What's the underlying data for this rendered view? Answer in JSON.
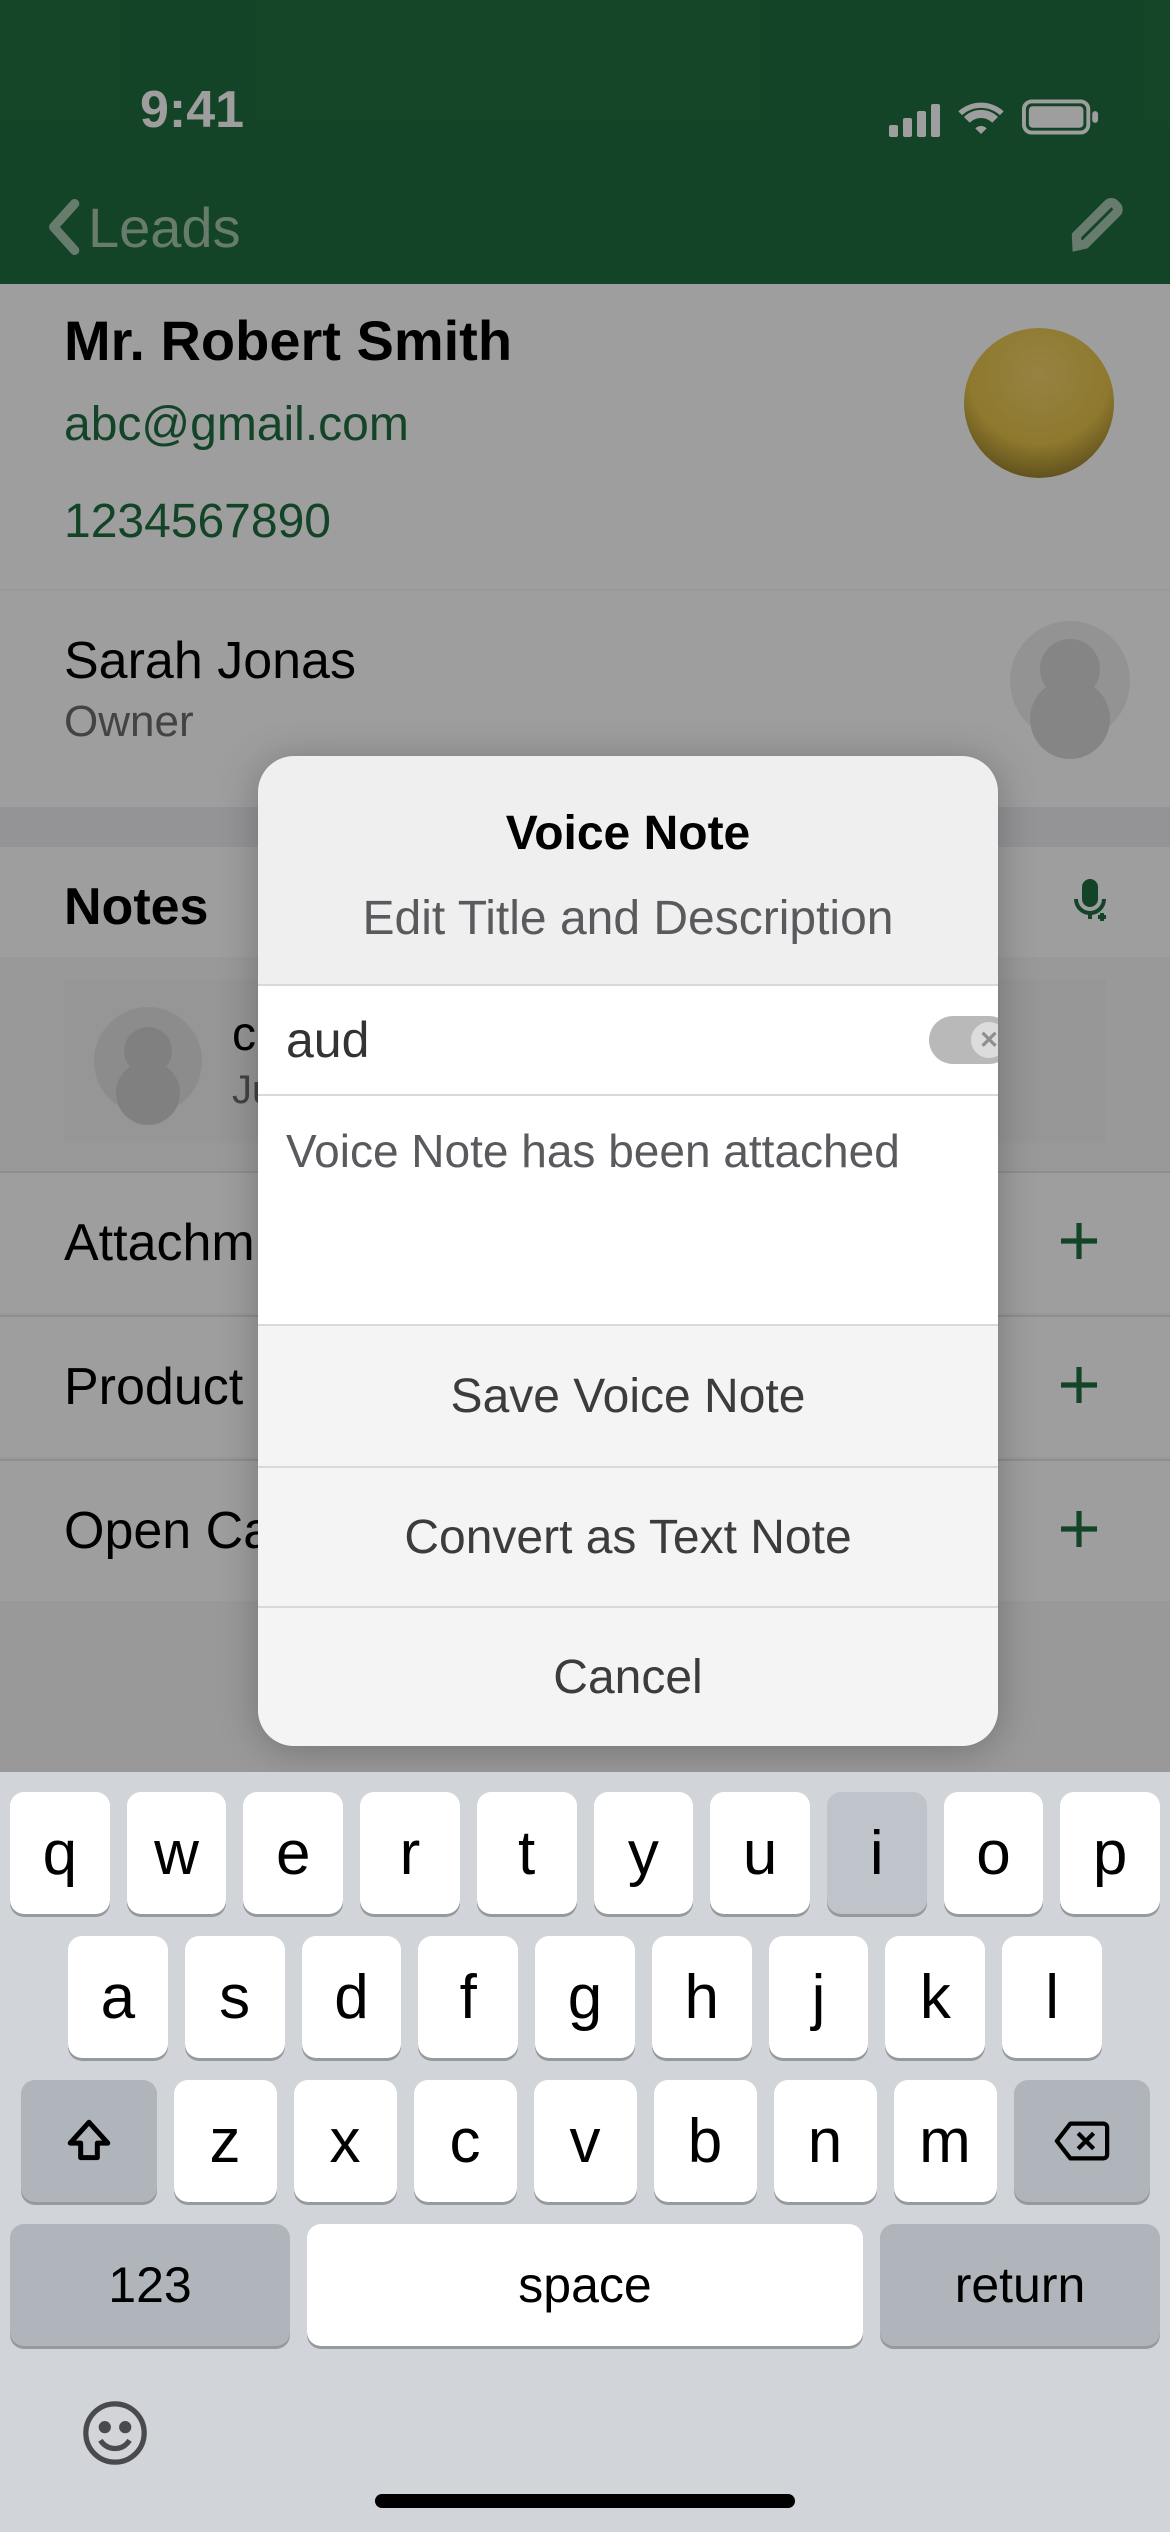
{
  "status": {
    "time": "9:41"
  },
  "nav": {
    "back_label": "Leads"
  },
  "lead": {
    "name": "Mr. Robert Smith",
    "email": "abc@gmail.com",
    "phone": "1234567890"
  },
  "owner": {
    "name": "Sarah Jonas",
    "role": "Owner"
  },
  "notes_section_title": "Notes",
  "note_item": {
    "title_partial": "co",
    "subtitle_partial": "Ju"
  },
  "rows": {
    "attachments": "Attachm",
    "products": "Product",
    "open_cases": "Open Ca"
  },
  "modal": {
    "title": "Voice Note",
    "subtitle": "Edit Title and Description",
    "input_value": "aud",
    "description": "Voice Note has been attached",
    "save_label": "Save Voice Note",
    "convert_label": "Convert as Text Note",
    "cancel_label": "Cancel"
  },
  "keyboard": {
    "row1": [
      "q",
      "w",
      "e",
      "r",
      "t",
      "y",
      "u",
      "i",
      "o",
      "p"
    ],
    "row2": [
      "a",
      "s",
      "d",
      "f",
      "g",
      "h",
      "j",
      "k",
      "l"
    ],
    "row3": [
      "z",
      "x",
      "c",
      "v",
      "b",
      "n",
      "m"
    ],
    "numbers_label": "123",
    "space_label": "space",
    "return_label": "return",
    "highlighted_key": "i"
  }
}
